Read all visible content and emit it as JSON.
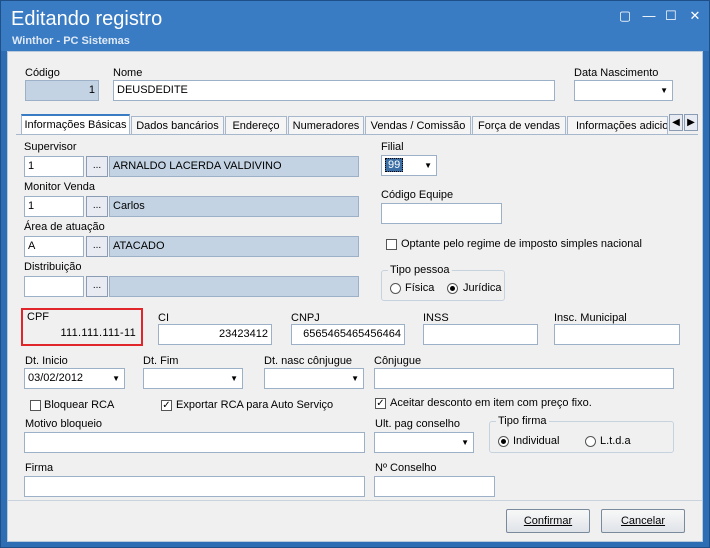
{
  "window": {
    "title": "Editando registro",
    "subtitle": "Winthor - PC Sistemas"
  },
  "header": {
    "codigo_label": "Código",
    "codigo_value": "1",
    "nome_label": "Nome",
    "nome_value": "DEUSDEDITE",
    "data_nascimento_label": "Data Nascimento",
    "data_nascimento_value": ""
  },
  "tabs": [
    {
      "label": "Informações Básicas",
      "active": true
    },
    {
      "label": "Dados bancários"
    },
    {
      "label": "Endereço"
    },
    {
      "label": "Numeradores"
    },
    {
      "label": "Vendas  / Comissão"
    },
    {
      "label": "Força de vendas"
    },
    {
      "label": "Informações adicio"
    }
  ],
  "form": {
    "supervisor_label": "Supervisor",
    "supervisor_code": "1",
    "supervisor_name": "ARNALDO LACERDA VALDIVINO",
    "monitor_label": "Monitor Venda",
    "monitor_code": "1",
    "monitor_name": "Carlos",
    "area_label": "Área de atuação",
    "area_code": "A",
    "area_name": "ATACADO",
    "distribuicao_label": "Distribuição",
    "distribuicao_code": "",
    "distribuicao_name": "",
    "lookup_button": "...",
    "filial_label": "Filial",
    "filial_value": "99",
    "codigo_equipe_label": "Código Equipe",
    "codigo_equipe_value": "",
    "optante_label": "Optante pelo regime de imposto simples nacional",
    "tipo_pessoa_label": "Tipo pessoa",
    "fisica_label": "Física",
    "juridica_label": "Jurídica",
    "cpf_label": "CPF",
    "cpf_value": "111.111.111-11",
    "ci_label": "CI",
    "ci_value": "23423412",
    "cnpj_label": "CNPJ",
    "cnpj_value": "6565465465456464",
    "inss_label": "INSS",
    "inss_value": "",
    "insc_municipal_label": "Insc. Municipal",
    "insc_municipal_value": "",
    "dt_inicio_label": "Dt. Inicio",
    "dt_inicio_value": "03/02/2012",
    "dt_fim_label": "Dt. Fim",
    "dt_fim_value": "",
    "dt_nasc_conjugue_label": "Dt. nasc cônjugue",
    "dt_nasc_conjugue_value": "",
    "conjugue_label": "Cônjugue",
    "conjugue_value": "",
    "bloquear_rca_label": "Bloquear RCA",
    "exportar_rca_label": "Exportar RCA para Auto Serviço",
    "aceitar_desconto_label": "Aceitar desconto em item com preço fixo.",
    "motivo_bloqueio_label": "Motivo bloqueio",
    "motivo_bloqueio_value": "",
    "ult_pag_conselho_label": "Ult. pag conselho",
    "ult_pag_conselho_value": "",
    "tipo_firma_label": "Tipo firma",
    "individual_label": "Individual",
    "ltda_label": "L.t.d.a",
    "firma_label": "Firma",
    "firma_value": "",
    "n_conselho_label": "Nº Conselho",
    "n_conselho_value": ""
  },
  "buttons": {
    "confirmar": "Confirmar",
    "cancelar": "Cancelar"
  },
  "colors": {
    "titlebar": "#3a7cc4",
    "readonly_field": "#c3d3e3",
    "highlight": "#e0262b"
  }
}
